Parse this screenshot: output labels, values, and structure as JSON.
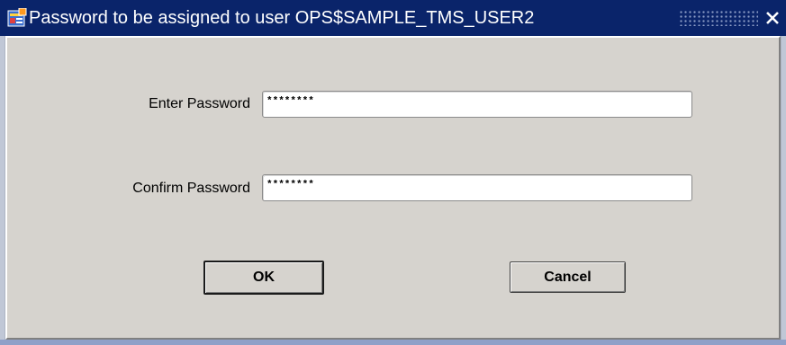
{
  "window": {
    "title": "Password to be assigned to user OPS$SAMPLE_TMS_USER2",
    "icons": {
      "app": "forms-app-icon",
      "close": "close-icon"
    }
  },
  "form": {
    "enter_password": {
      "label": "Enter Password",
      "value": "********"
    },
    "confirm_password": {
      "label": "Confirm Password",
      "value": "********"
    }
  },
  "buttons": {
    "ok_label": "OK",
    "cancel_label": "Cancel"
  },
  "colors": {
    "titlebar": "#0a246a",
    "dialog_bg": "#d6d3ce"
  }
}
